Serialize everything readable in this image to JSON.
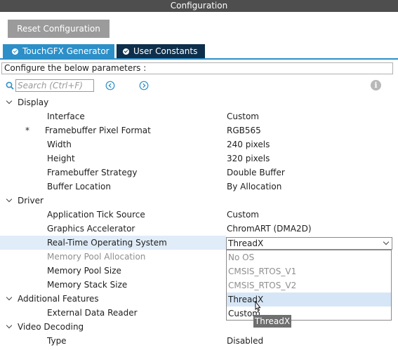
{
  "window": {
    "title": "Configuration"
  },
  "toolbar": {
    "reset_label": "Reset Configuration"
  },
  "tabs": [
    {
      "label": "TouchGFX Generator",
      "active": true,
      "icon": "check-circle-icon"
    },
    {
      "label": "User Constants",
      "active": false,
      "icon": "check-circle-icon"
    }
  ],
  "params_note": "Configure the below parameters :",
  "search": {
    "placeholder": "Search (Ctrl+F)",
    "value": "",
    "icon": "search-icon"
  },
  "groups": [
    {
      "label": "Display",
      "items": [
        {
          "label": "Interface",
          "value": "Custom"
        },
        {
          "label": "Framebuffer Pixel Format",
          "value": "RGB565",
          "marker": "*"
        },
        {
          "label": "Width",
          "value": "240 pixels"
        },
        {
          "label": "Height",
          "value": "320 pixels"
        },
        {
          "label": "Framebuffer Strategy",
          "value": "Double Buffer"
        },
        {
          "label": "Buffer Location",
          "value": "By Allocation"
        }
      ]
    },
    {
      "label": "Driver",
      "items": [
        {
          "label": "Application Tick Source",
          "value": "Custom"
        },
        {
          "label": "Graphics Accelerator",
          "value": "ChromART (DMA2D)"
        },
        {
          "label": "Real-Time Operating System",
          "value": "ThreadX"
        },
        {
          "label": "Memory Pool Allocation",
          "value": ""
        },
        {
          "label": "Memory Pool Size",
          "value": ""
        },
        {
          "label": "Memory Stack Size",
          "value": ""
        }
      ]
    },
    {
      "label": "Additional Features",
      "items": [
        {
          "label": "External Data Reader",
          "value": ""
        }
      ]
    },
    {
      "label": "Video Decoding",
      "items": [
        {
          "label": "Type",
          "value": "Disabled"
        }
      ]
    }
  ],
  "rtos_select": {
    "selected": "ThreadX",
    "options": [
      "No OS",
      "CMSIS_RTOS_V1",
      "CMSIS_RTOS_V2",
      "ThreadX",
      "Custom"
    ],
    "tooltip": "ThreadX"
  },
  "colors": {
    "titlebar": "#4e4e4e",
    "tab_active": "#2d8fc8",
    "tab_inactive": "#0e2f4b",
    "reset_button": "#9b9b9b",
    "selected_row": "#e0ecf8"
  }
}
